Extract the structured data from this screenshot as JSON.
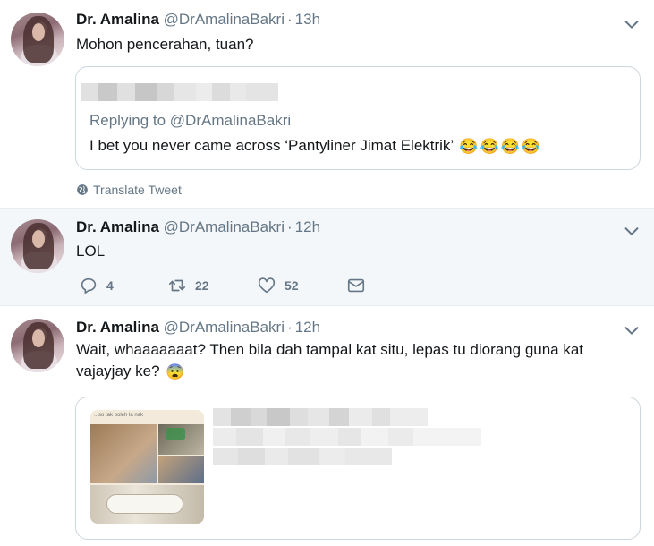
{
  "tweets": [
    {
      "name": "Dr. Amalina",
      "handle": "@DrAmalinaBakri",
      "separator": "·",
      "time": "13h",
      "text": "Mohon pencerahan, tuan?",
      "quote": {
        "replying_prefix": "Replying to",
        "replying_handle": "@DrAmalinaBakri",
        "text": "I bet you never came across ‘Pantyliner Jimat Elektrik’",
        "emojis": [
          "😂",
          "😂",
          "😂",
          "😂"
        ]
      },
      "translate_label": "Translate Tweet"
    },
    {
      "name": "Dr. Amalina",
      "handle": "@DrAmalinaBakri",
      "separator": "·",
      "time": "12h",
      "text": "LOL",
      "actions": {
        "replies": "4",
        "retweets": "22",
        "likes": "52"
      }
    },
    {
      "name": "Dr. Amalina",
      "handle": "@DrAmalinaBakri",
      "separator": "·",
      "time": "12h",
      "text_line1": "Wait, whaaaaaaat? Then bila dah tampal kat situ, lepas tu diorang guna kat",
      "text_line2": "vajayjay ke?",
      "text_emoji": "😨",
      "card": {
        "image_caption": "...so tak boleh la nak"
      }
    }
  ],
  "icons": {
    "caret": "chevron-down-icon",
    "globe": "globe-icon",
    "reply": "reply-icon",
    "retweet": "retweet-icon",
    "like": "heart-icon",
    "message": "envelope-icon"
  },
  "colors": {
    "text": "#14171a",
    "secondary": "#657786",
    "border": "#ccd6dd",
    "highlight_bg": "#f4f7f9"
  }
}
